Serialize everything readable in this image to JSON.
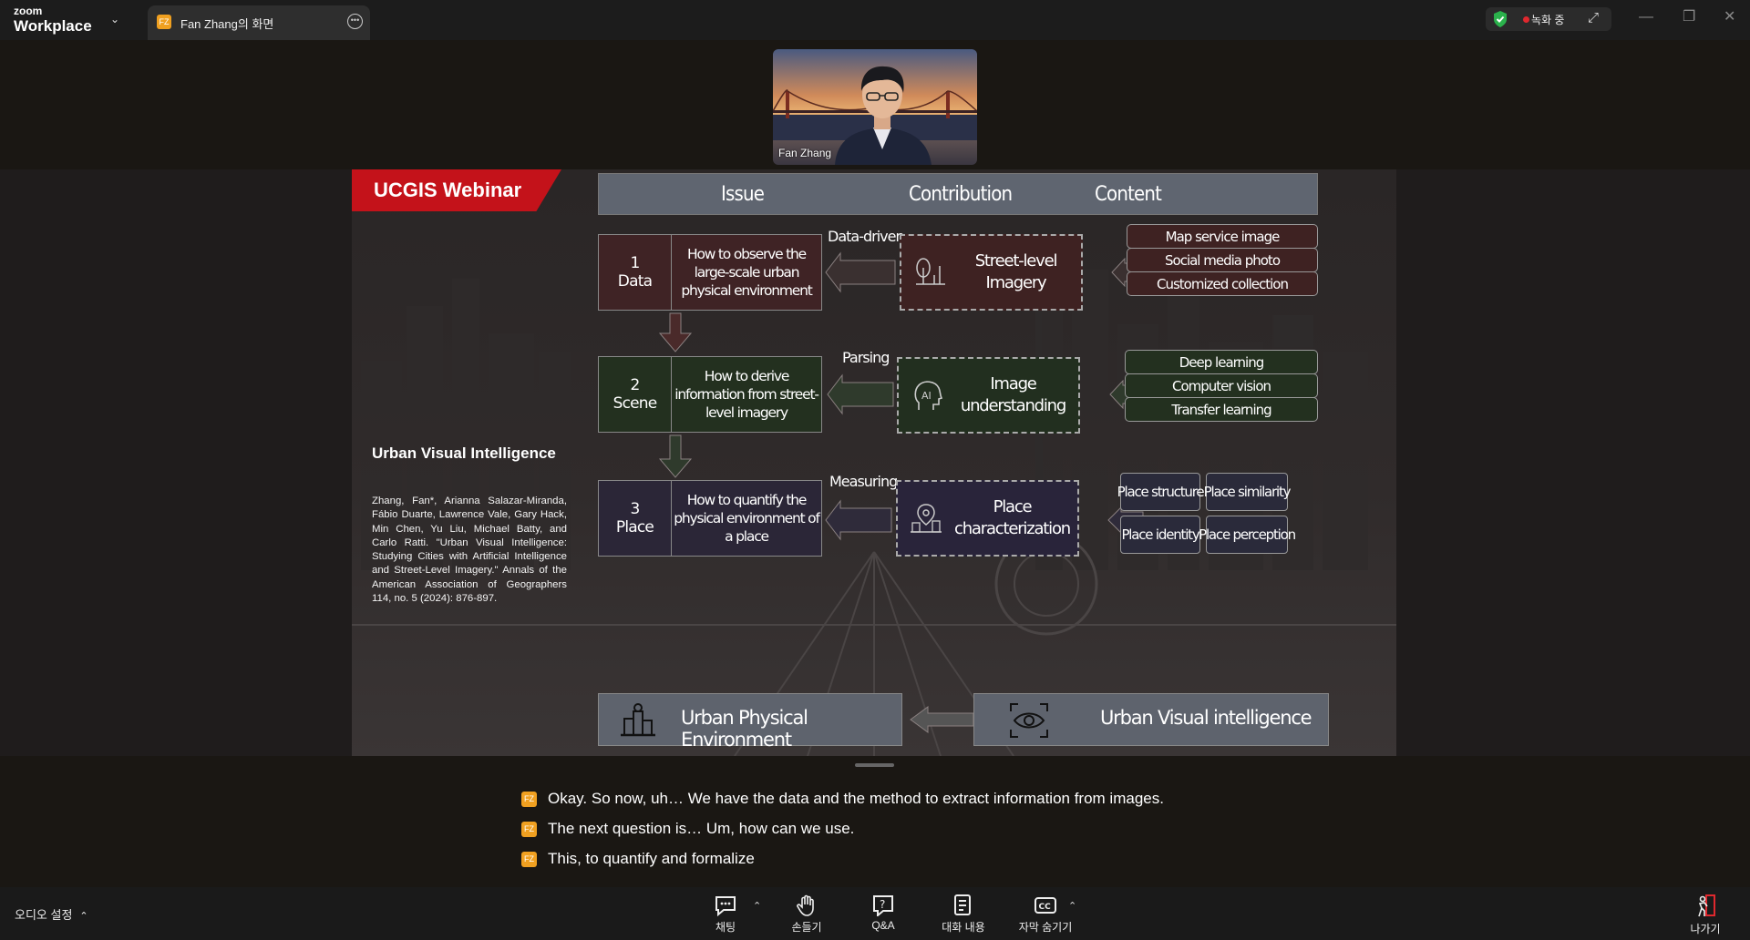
{
  "titlebar": {
    "logo_small": "zoom",
    "logo_large": "Workplace",
    "tab_avatar": "FZ",
    "tab_title": "Fan Zhang의 화면",
    "recording_label": "녹화 중",
    "icons": [
      "chevron-down-icon",
      "more-icon",
      "shield-check-icon",
      "expand-icon",
      "minimize-icon",
      "restore-icon",
      "close-icon"
    ]
  },
  "video": {
    "name": "Fan Zhang"
  },
  "slide": {
    "banner": "UCGIS Webinar",
    "side_title": "Urban Visual Intelligence",
    "citation": "Zhang, Fan*, Arianna Salazar-Miranda, Fábio Duarte, Lawrence Vale, Gary Hack, Min Chen, Yu Liu, Michael Batty, and Carlo Ratti. \"Urban Visual Intelligence: Studying Cities with Artificial Intelligence and Street-Level Imagery.\" Annals of the American Association of Geographers 114, no. 5 (2024): 876-897.",
    "headers": {
      "issue": "Issue",
      "contribution": "Contribution",
      "content": "Content"
    },
    "rows": [
      {
        "num": "1",
        "name": "Data",
        "text": "How to observe the large-scale urban physical environment",
        "verb": "Data-driven",
        "method": "Street-level Imagery",
        "contents": [
          "Map service image",
          "Social media photo",
          "Customized collection"
        ]
      },
      {
        "num": "2",
        "name": "Scene",
        "text": "How to derive information from street-level imagery",
        "verb": "Parsing",
        "method": "Image understanding",
        "contents": [
          "Deep learning",
          "Computer vision",
          "Transfer learning"
        ]
      },
      {
        "num": "3",
        "name": "Place",
        "text": "How to quantify the physical environment of a place",
        "verb": "Measuring",
        "method": "Place characterization",
        "contents": [
          "Place structure",
          "Place similarity",
          "Place identity",
          "Place perception"
        ]
      }
    ],
    "bottom_left": "Urban Physical Environment",
    "bottom_right": "Urban Visual intelligence"
  },
  "captions": {
    "avatar": "FZ",
    "lines": [
      "Okay. So now, uh… We have the data and the method to extract information from images.",
      "The next question is… Um, how can we use.",
      "This, to quantify and formalize"
    ]
  },
  "toolbar": {
    "audio": "오디오 설정",
    "chat": "채팅",
    "raise_hand": "손들기",
    "qa": "Q&A",
    "transcript": "대화 내용",
    "hide_captions": "자막 숨기기",
    "leave": "나가기"
  },
  "colors": {
    "accent_red": "#c4121a",
    "recording_dot": "#e0282e",
    "shield_green": "#2bb24c",
    "caption_avatar": "#f0a020"
  }
}
